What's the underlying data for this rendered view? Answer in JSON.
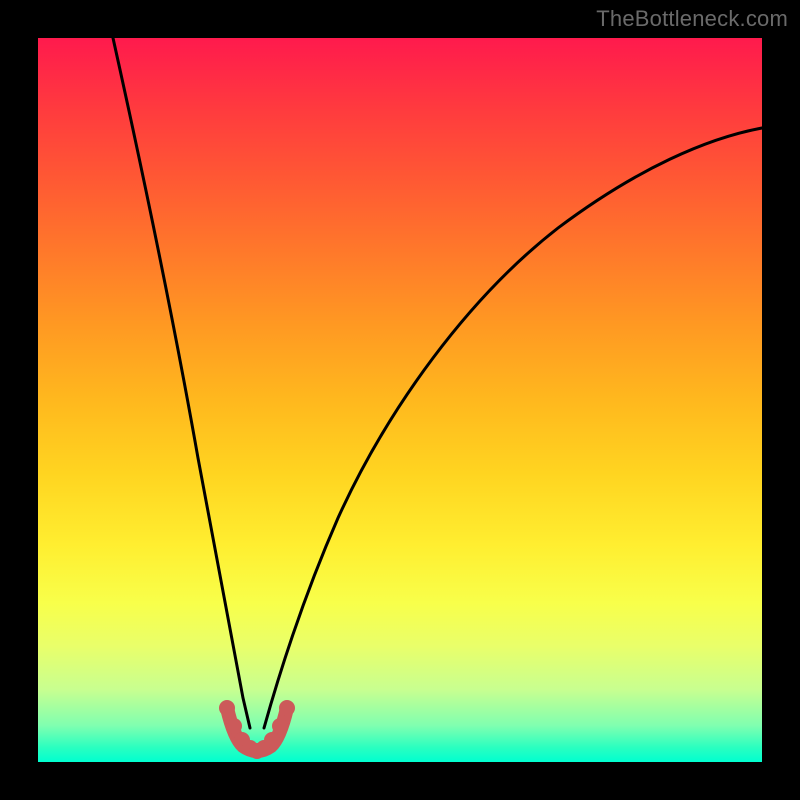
{
  "watermark": {
    "text": "TheBottleneck.com"
  },
  "colors": {
    "background": "#000000",
    "curve": "#000000",
    "marker_stroke": "#cc5a5a",
    "marker_fill": "#cc5a5a",
    "gradient_top": "#ff1a4d",
    "gradient_bottom": "#00ffd0"
  },
  "chart_data": {
    "type": "line",
    "title": "",
    "xlabel": "",
    "ylabel": "",
    "xlim": [
      0,
      100
    ],
    "ylim": [
      0,
      100
    ],
    "grid": false,
    "legend": false,
    "series": [
      {
        "name": "left-branch",
        "x": [
          10.4,
          11,
          12,
          13,
          14,
          15,
          16,
          17,
          18,
          19,
          20,
          21,
          22,
          23,
          24,
          25,
          26,
          27,
          28
        ],
        "y": [
          100,
          94,
          84.5,
          76,
          68.5,
          61.5,
          55,
          49,
          43.5,
          38.5,
          33.5,
          29,
          25,
          21,
          17.5,
          14,
          11,
          8,
          5
        ]
      },
      {
        "name": "right-branch",
        "x": [
          32,
          33,
          34,
          35,
          37,
          40,
          44,
          48,
          52,
          56,
          60,
          65,
          70,
          75,
          80,
          85,
          90,
          95,
          100
        ],
        "y": [
          5,
          8.5,
          11.5,
          14.5,
          20,
          27.5,
          36,
          43,
          49,
          54,
          58.5,
          63.5,
          67.5,
          71,
          74,
          76.5,
          78.8,
          80.8,
          82.5
        ]
      },
      {
        "name": "bottom-markers",
        "x": [
          26.5,
          27.5,
          28.5,
          29.3,
          30,
          30.7,
          31.5,
          32.5,
          33.5
        ],
        "y": [
          6.2,
          4.2,
          2.8,
          2.2,
          2.0,
          2.2,
          2.8,
          4.2,
          6.2
        ]
      }
    ],
    "minimum": {
      "x": 30,
      "y": 2.0
    }
  }
}
